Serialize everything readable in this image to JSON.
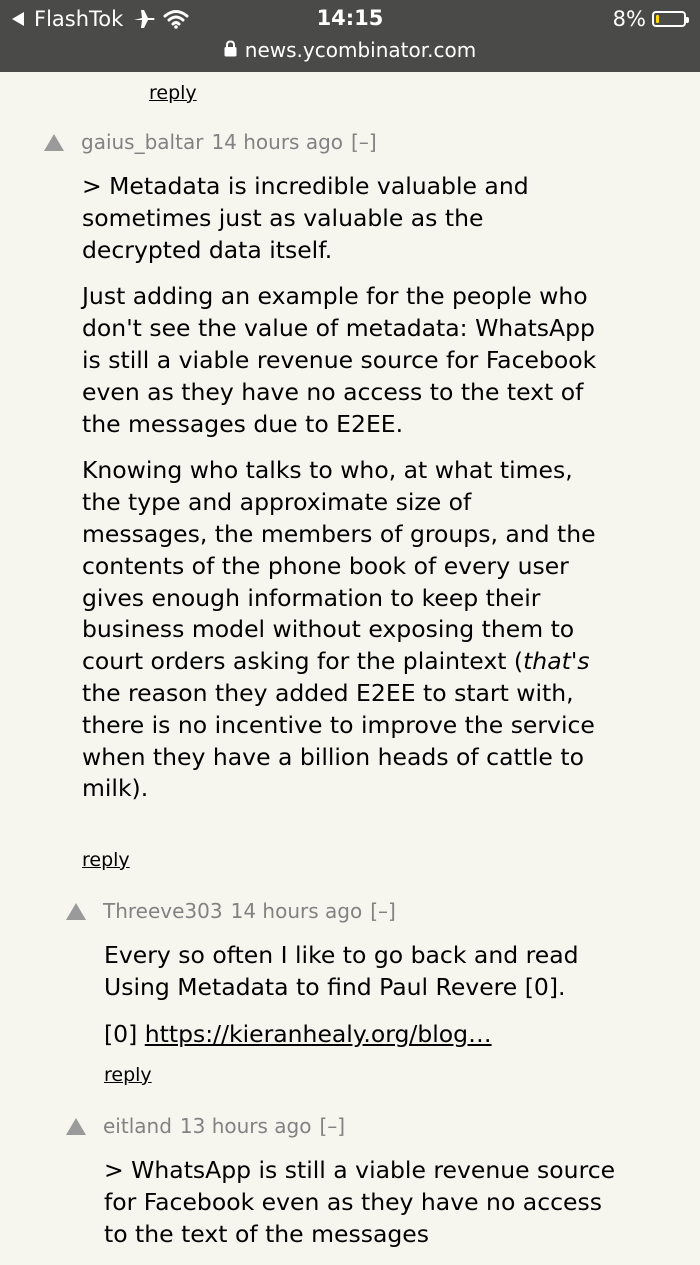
{
  "status_bar": {
    "carrier": "FlashTok",
    "time": "14:15",
    "battery": "8%",
    "battery_level": 0.08,
    "icons": [
      "back-arrow-icon",
      "airplane-icon",
      "wifi-icon",
      "battery-icon"
    ]
  },
  "url_bar": {
    "domain": "news.ycombinator.com",
    "icon": "lock-icon"
  },
  "reply_label": "reply",
  "comments": [
    {
      "user": "gaius_baltar",
      "age": "14 hours ago",
      "toggle": "[–]",
      "paragraphs": [
        "> Metadata is incredible valuable and sometimes just as valuable as the decrypted data itself.",
        "Just adding an example for the people who don't see the value of metadata: WhatsApp is still a viable revenue source for Facebook even as they have no access to the text of the messages due to E2EE."
      ],
      "p3_before": "Knowing who talks to who, at what times, the type and approximate size of messages, the members of groups, and the contents of the phone book of every user gives enough information to keep their business model without exposing them to court orders asking for the plaintext (",
      "p3_italic": "that's",
      "p3_after": " the reason they added E2EE to start with, there is no incentive to improve the service when they have a billion heads of cattle to milk).",
      "reply": "reply"
    },
    {
      "user": "Threeve303",
      "age": "14 hours ago",
      "toggle": "[–]",
      "p1": "Every so often I like to go back and read Using Metadata to find Paul Revere [0].",
      "p2_prefix": "[0] ",
      "p2_link": "https://kieranhealy.org/blog…",
      "reply": "reply"
    },
    {
      "user": "eitland",
      "age": "13 hours ago",
      "toggle": "[–]",
      "p1": "> WhatsApp is still a viable revenue source for Facebook even as they have no access to the text of the messages"
    }
  ]
}
